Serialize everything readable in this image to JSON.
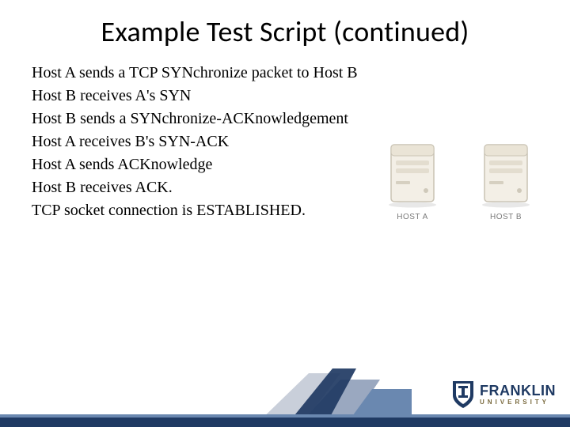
{
  "title": "Example Test Script (continued)",
  "body_lines": [
    "Host A sends a TCP SYNchronize packet to Host B",
    "Host B receives A's SYN",
    "Host B sends a SYNchronize-ACKnowledgement",
    "Host A receives B's SYN-ACK",
    "Host A sends ACKnowledge",
    "Host B receives ACK.",
    "TCP socket connection is ESTABLISHED."
  ],
  "hosts": {
    "a_label": "HOST A",
    "b_label": "HOST B"
  },
  "logo": {
    "name": "FRANKLIN",
    "subname": "UNIVERSITY"
  },
  "colors": {
    "brand_dark": "#1f3a63",
    "brand_light": "#6a88b0",
    "gold": "#7a6a3e"
  }
}
